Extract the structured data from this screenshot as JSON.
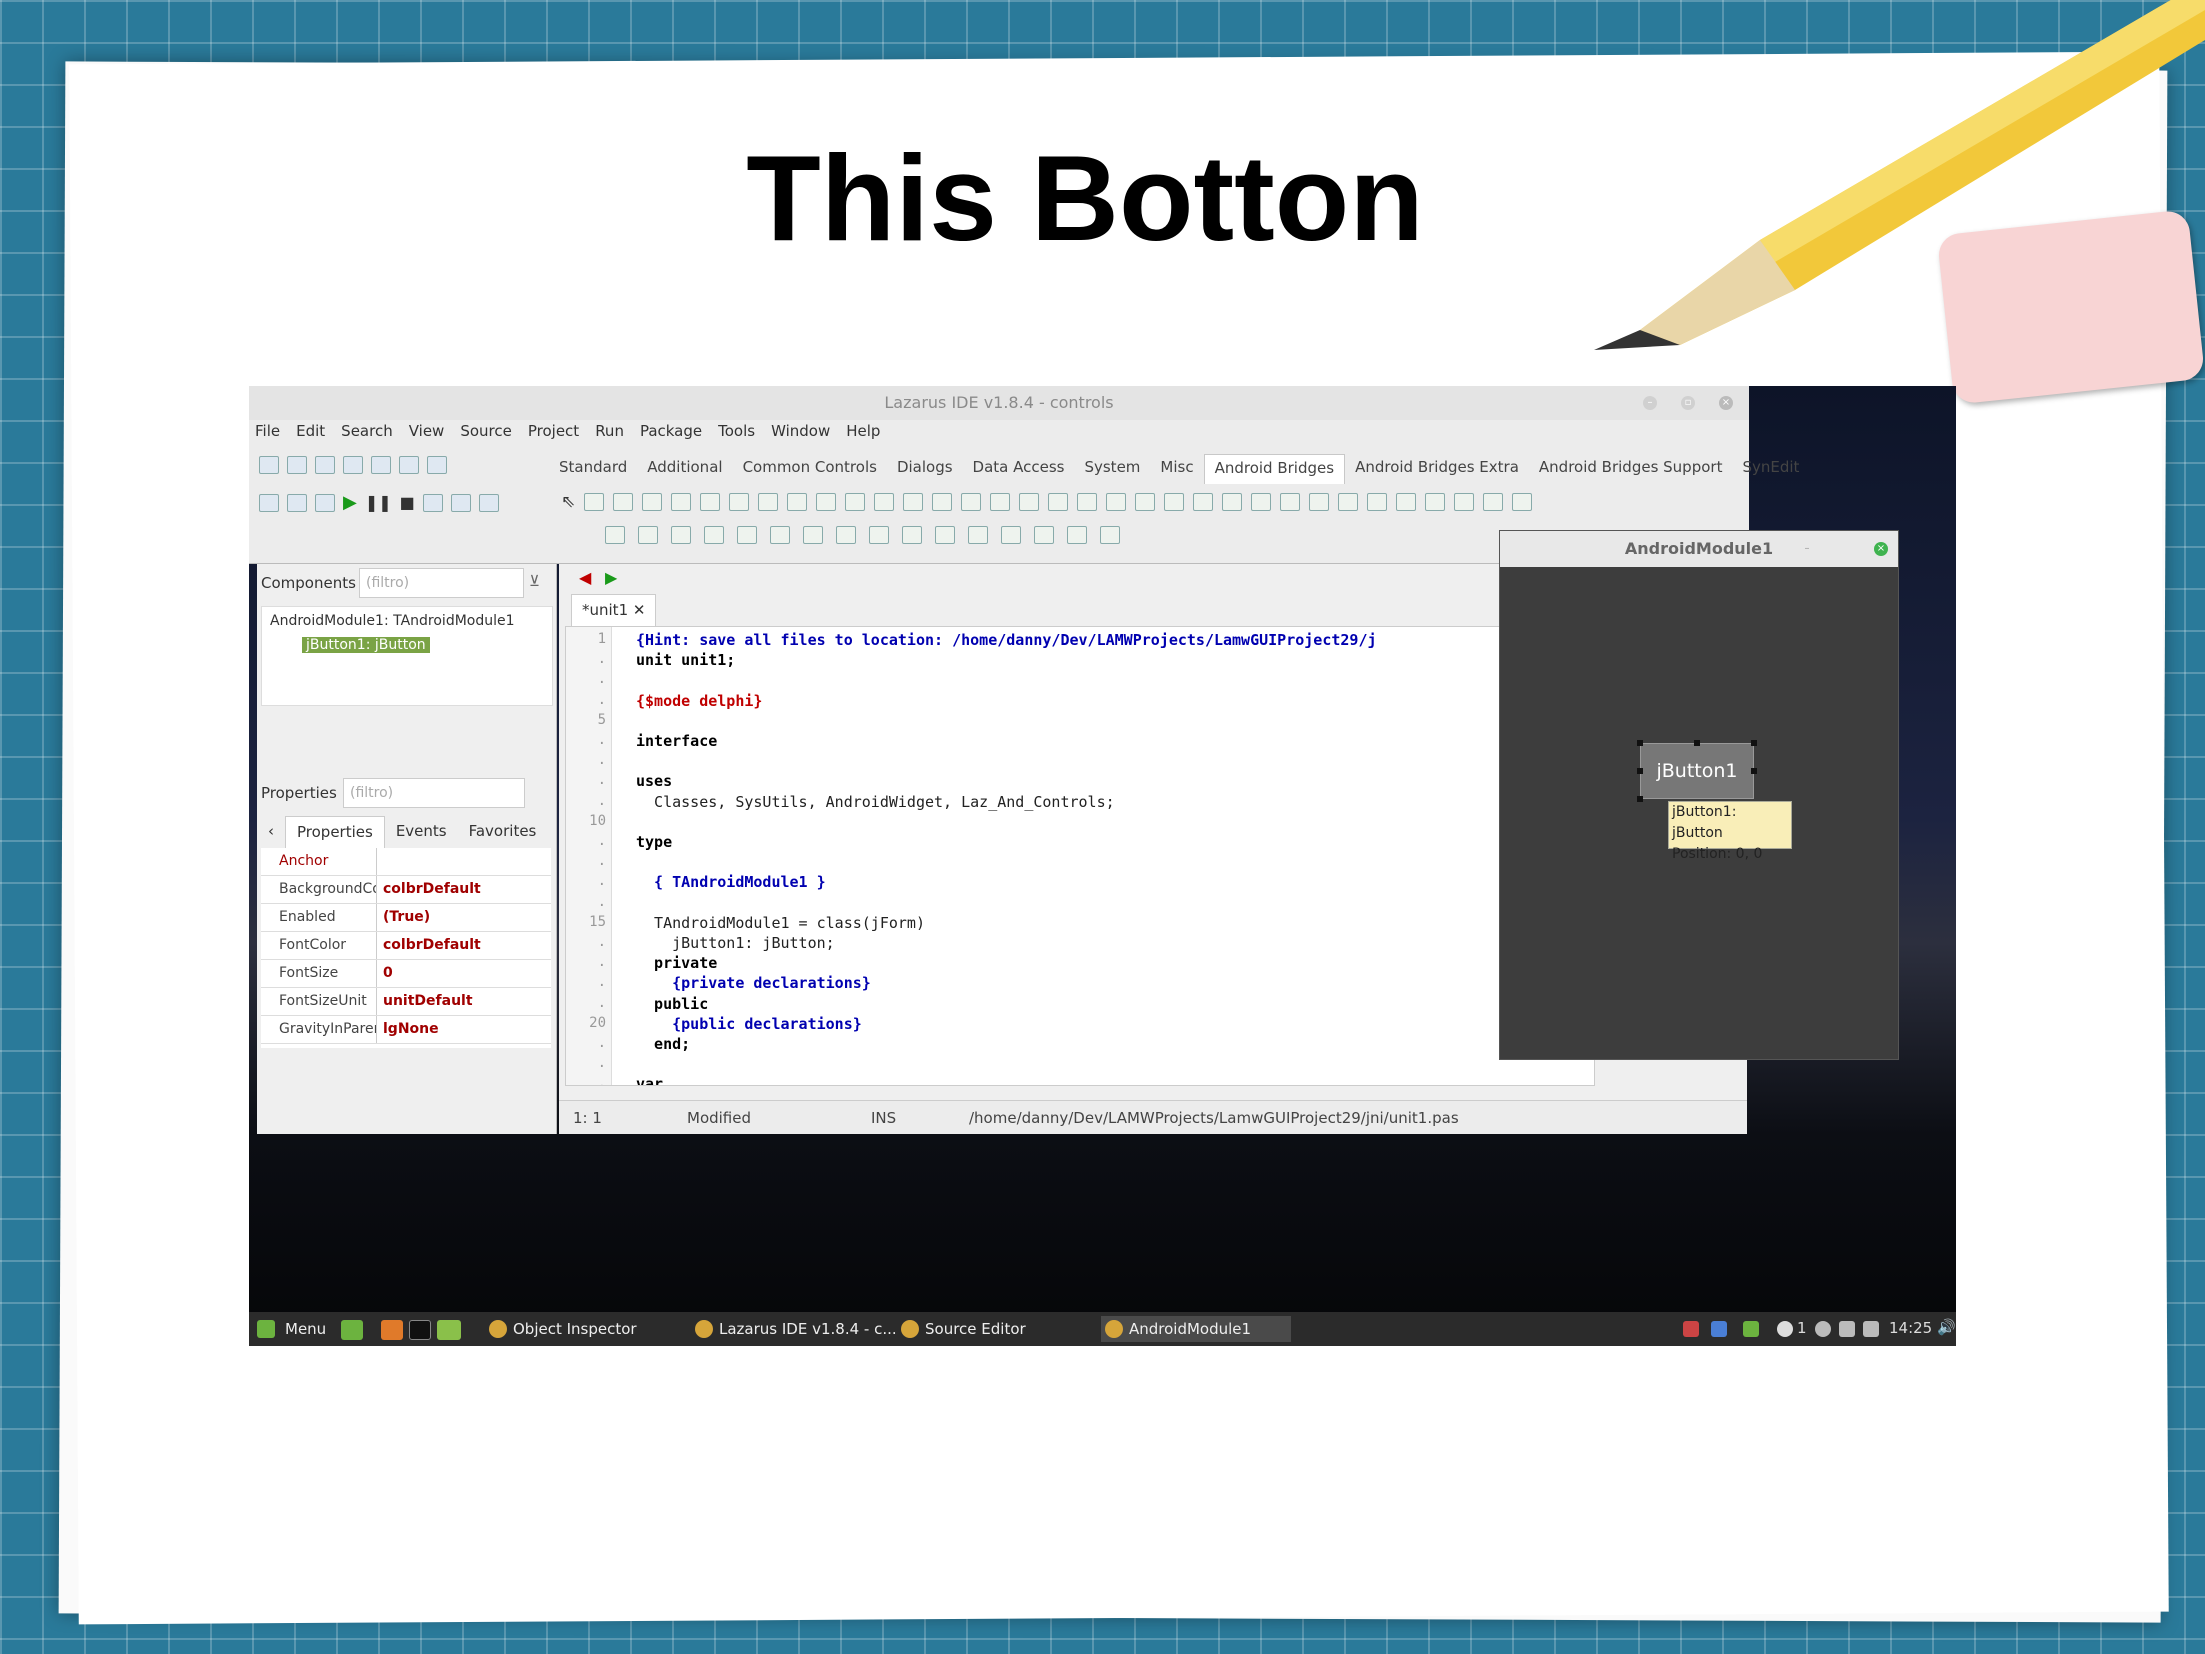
{
  "slide_title": "This Botton",
  "ide": {
    "window_title": "Lazarus IDE v1.8.4 - controls",
    "menu": [
      "File",
      "Edit",
      "Search",
      "View",
      "Source",
      "Project",
      "Run",
      "Package",
      "Tools",
      "Window",
      "Help"
    ],
    "palette_tabs": [
      "Standard",
      "Additional",
      "Common Controls",
      "Dialogs",
      "Data Access",
      "System",
      "Misc",
      "Android Bridges",
      "Android Bridges Extra",
      "Android Bridges Support",
      "SynEdit"
    ],
    "active_palette_tab": "Android Bridges"
  },
  "inspector": {
    "components_label": "Components",
    "filter_placeholder": "(filtro)",
    "tree_root": "AndroidModule1: TAndroidModule1",
    "tree_child": "jButton1: jButton",
    "properties_label": "Properties",
    "tabs": [
      "Properties",
      "Events",
      "Favorites"
    ],
    "rows": [
      {
        "name": "Anchor",
        "value": ""
      },
      {
        "name": "BackgroundColo",
        "value": "colbrDefault"
      },
      {
        "name": "Enabled",
        "value": "(True)"
      },
      {
        "name": "FontColor",
        "value": "colbrDefault"
      },
      {
        "name": "FontSize",
        "value": "0"
      },
      {
        "name": "FontSizeUnit",
        "value": "unitDefault"
      },
      {
        "name": "GravityInParent",
        "value": "lgNone"
      }
    ]
  },
  "editor": {
    "tab_label": "*unit1",
    "line_numbers": [
      "1",
      ".",
      ".",
      ".",
      "5",
      ".",
      ".",
      ".",
      ".",
      "10",
      ".",
      ".",
      ".",
      ".",
      "15",
      ".",
      ".",
      ".",
      ".",
      "20",
      ".",
      ".",
      "."
    ],
    "lines": [
      "{Hint: save all files to location: /home/danny/Dev/LAMWProjects/LamwGUIProject29/j",
      "unit unit1;",
      "",
      "{$mode delphi}",
      "",
      "interface",
      "",
      "uses",
      "  Classes, SysUtils, AndroidWidget, Laz_And_Controls;",
      "",
      "type",
      "",
      "  { TAndroidModule1 }",
      "",
      "  TAndroidModule1 = class(jForm)",
      "    jButton1: jButton;",
      "  private",
      "    {private declarations}",
      "  public",
      "    {public declarations}",
      "  end;",
      "",
      "var"
    ],
    "status_pos": "1: 1",
    "status_modified": "Modified",
    "status_mode": "INS",
    "status_path": "/home/danny/Dev/LAMWProjects/LamwGUIProject29/jni/unit1.pas"
  },
  "form_designer": {
    "title": "AndroidModule1",
    "button_caption": "jButton1",
    "tooltip_line1": "jButton1: jButton",
    "tooltip_line2": "Position: 0, 0"
  },
  "taskbar": {
    "menu_label": "Menu",
    "tasks": [
      "Object Inspector",
      "Lazarus IDE v1.8.4 - c...",
      "Source Editor",
      "AndroidModule1"
    ],
    "tray_count": "1",
    "clock": "14:25"
  }
}
